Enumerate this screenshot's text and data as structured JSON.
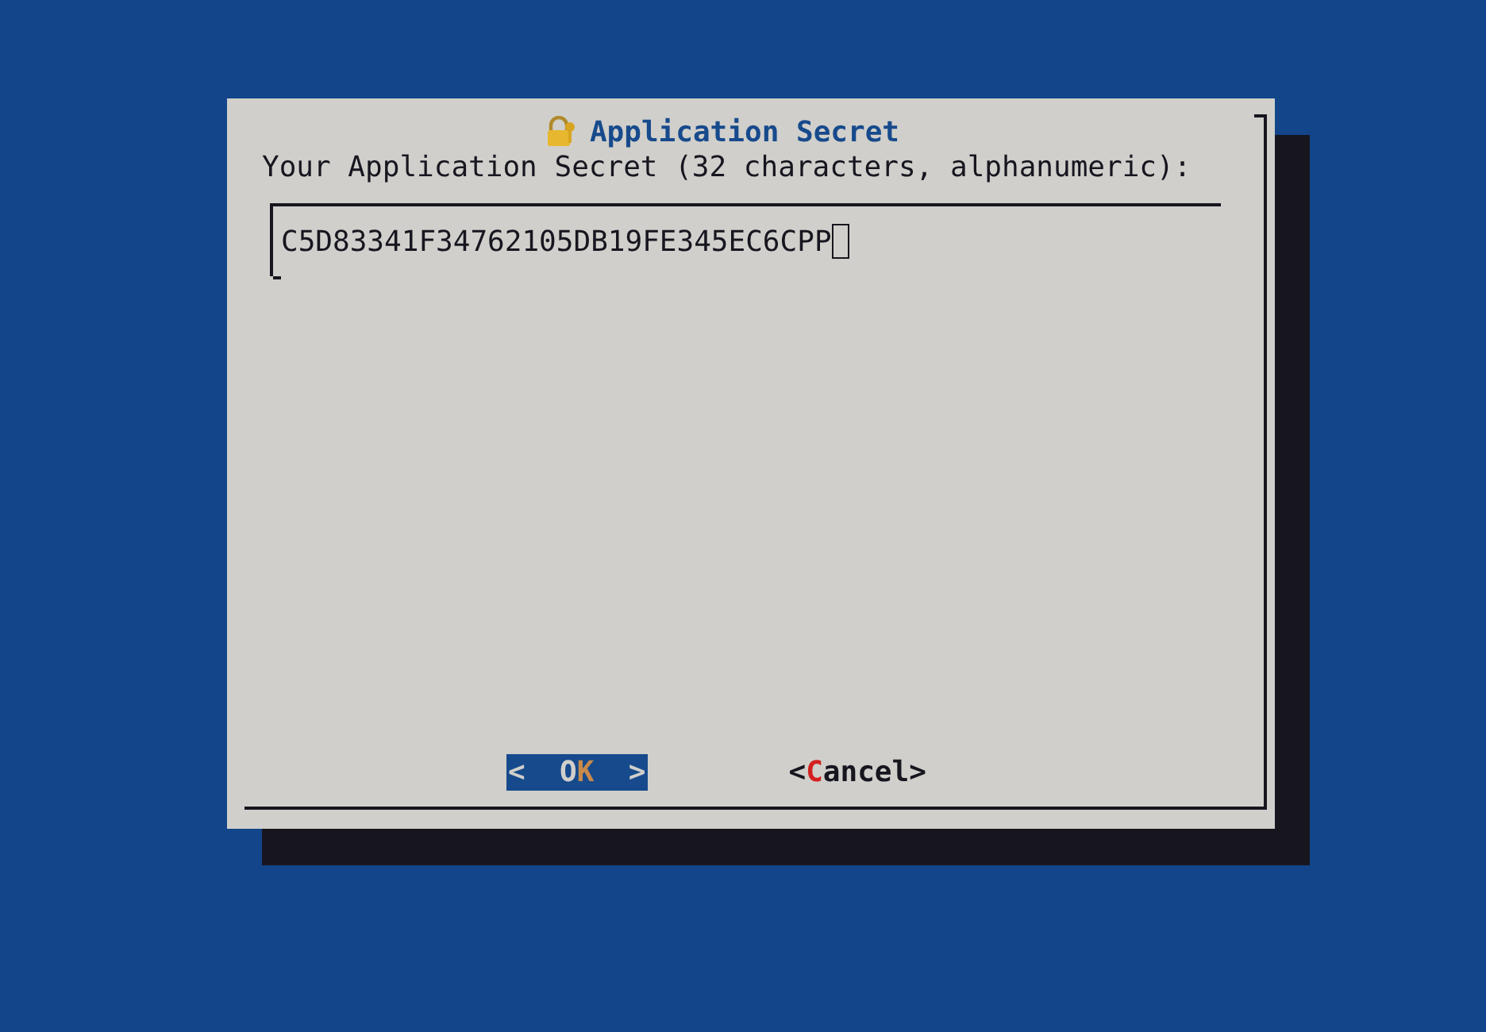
{
  "dialog": {
    "title": "Application Secret",
    "prompt": "Your Application Secret (32 characters, alphanumeric):",
    "input": {
      "value": "C5D83341F34762105DB19FE345EC6CPP"
    },
    "buttons": [
      {
        "open": "<",
        "before": "O",
        "hotkey": "K",
        "close": ">",
        "selected": true
      },
      {
        "open": "<",
        "hotkey": "C",
        "after": "ancel",
        "close": ">",
        "selected": false
      }
    ]
  }
}
